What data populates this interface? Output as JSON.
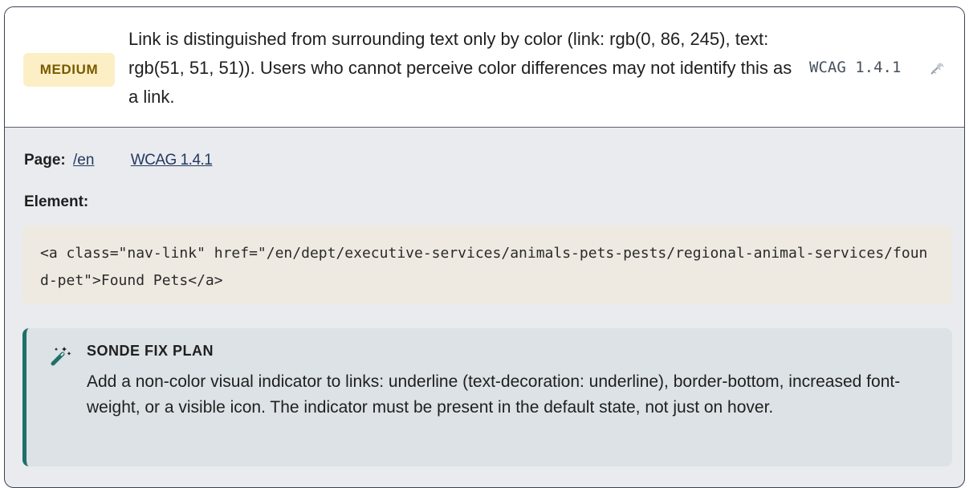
{
  "issue": {
    "severity": "MEDIUM",
    "message": "Link is distinguished from surrounding text only by color (link: rgb(0, 86, 245), text: rgb(51, 51, 51)). Users who cannot perceive color differences may not identify this as a link.",
    "wcag_code": "WCAG 1.4.1",
    "action_icon": "wrench-icon"
  },
  "details": {
    "page_label": "Page:",
    "page_link": "/en",
    "wcag_link": "WCAG 1.4.1",
    "element_label": "Element:",
    "element_code": "<a class=\"nav-link\" href=\"/en/dept/executive-services/animals-pets-pests/regional-animal-services/found-pet\">Found Pets</a>"
  },
  "fix": {
    "icon": "magic-wand-icon",
    "title": "SONDE FIX PLAN",
    "body": "Add a non-color visual indicator to links: underline (text-decoration: underline), border-bottom, increased font-weight, or a visible icon. The indicator must be present in the default state, not just on hover."
  },
  "colors": {
    "severity_bg": "#fcefc6",
    "severity_text": "#7a5a00",
    "fix_accent": "#1f6f6a",
    "code_bg": "#efeae1"
  }
}
